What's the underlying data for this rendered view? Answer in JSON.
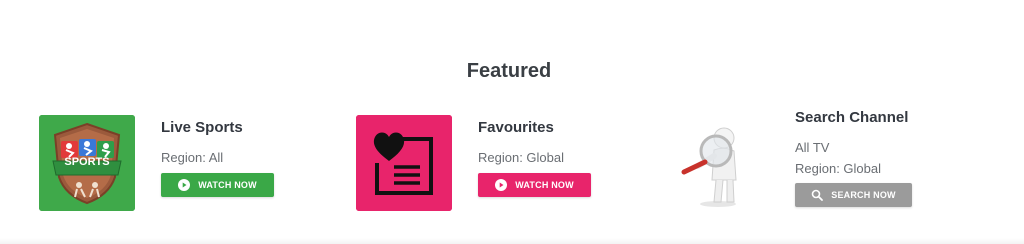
{
  "section": {
    "title": "Featured"
  },
  "cards": [
    {
      "title": "Live Sports",
      "lines": [
        "Region: All"
      ],
      "button": {
        "label": "WATCH NOW",
        "icon": "play-circle-icon",
        "color": "#3aa847"
      },
      "thumb": {
        "bg": "#3fa94a",
        "badge_text": "SPORTS"
      }
    },
    {
      "title": "Favourites",
      "lines": [
        "Region: Global"
      ],
      "button": {
        "label": "WATCH NOW",
        "icon": "play-circle-icon",
        "color": "#e8246b"
      },
      "thumb": {
        "bg": "#e8246b"
      }
    },
    {
      "title": "Search Channel",
      "lines": [
        "All TV",
        "Region: Global"
      ],
      "button": {
        "label": "SEARCH NOW",
        "icon": "search-icon",
        "color": "#9b9b9b"
      }
    }
  ]
}
